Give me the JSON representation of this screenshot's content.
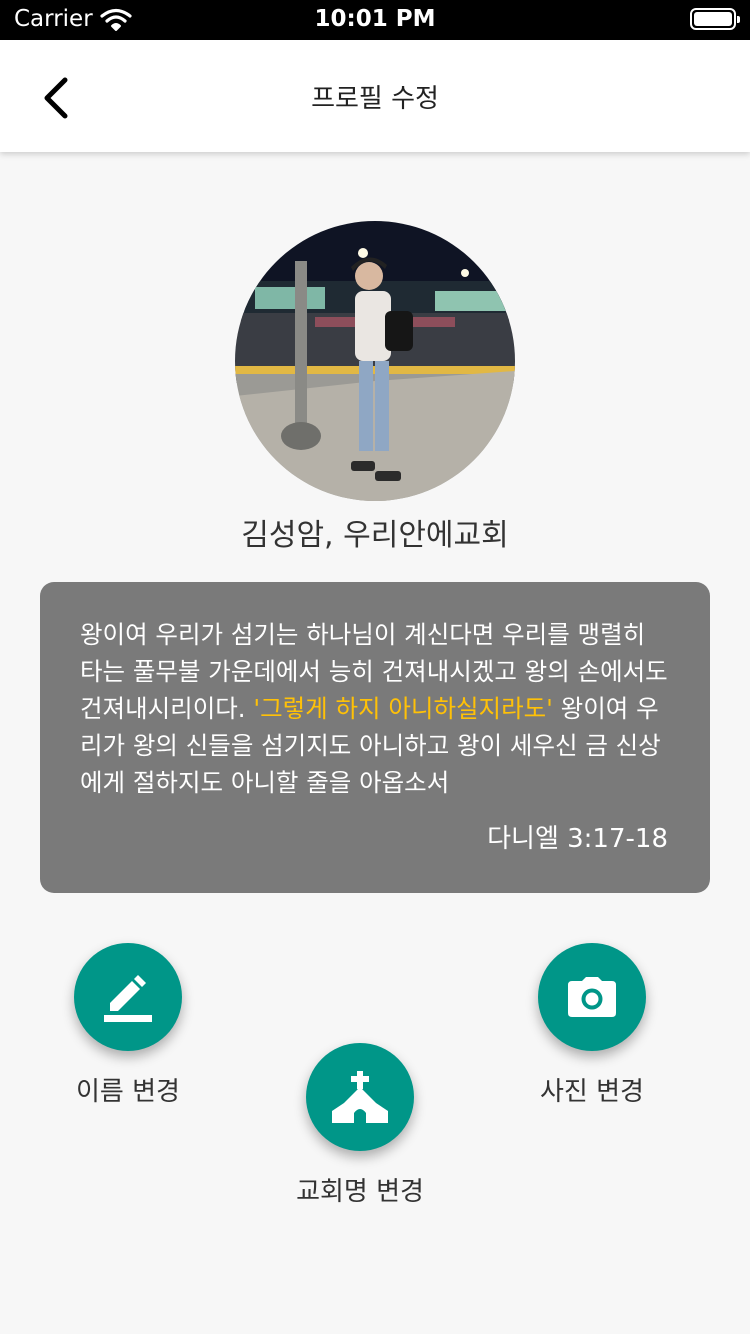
{
  "status_bar": {
    "carrier": "Carrier",
    "time": "10:01 PM"
  },
  "nav": {
    "title": "프로필 수정"
  },
  "profile": {
    "name": "김성암, 우리안에교회"
  },
  "verse": {
    "before": "왕이여 우리가 섬기는 하나님이 계신다면 우리를 맹렬히 타는 풀무불 가운데에서 능히 건져내시겠고 왕의 손에서도 건져내시리이다. ",
    "highlight": "'그렇게 하지 아니하실지라도'",
    "after": " 왕이여 우리가 왕의 신들을 섬기지도 아니하고 왕이 세우신 금 신상에게 절하지도 아니할 줄을 아옵소서",
    "reference": "다니엘 3:17-18",
    "highlight_color": "#ffc107"
  },
  "actions": {
    "change_name": "이름 변경",
    "change_church": "교회명 변경",
    "change_photo": "사진 변경"
  },
  "colors": {
    "accent": "#009688",
    "card": "#7a7a7a",
    "background": "#f7f7f7"
  }
}
